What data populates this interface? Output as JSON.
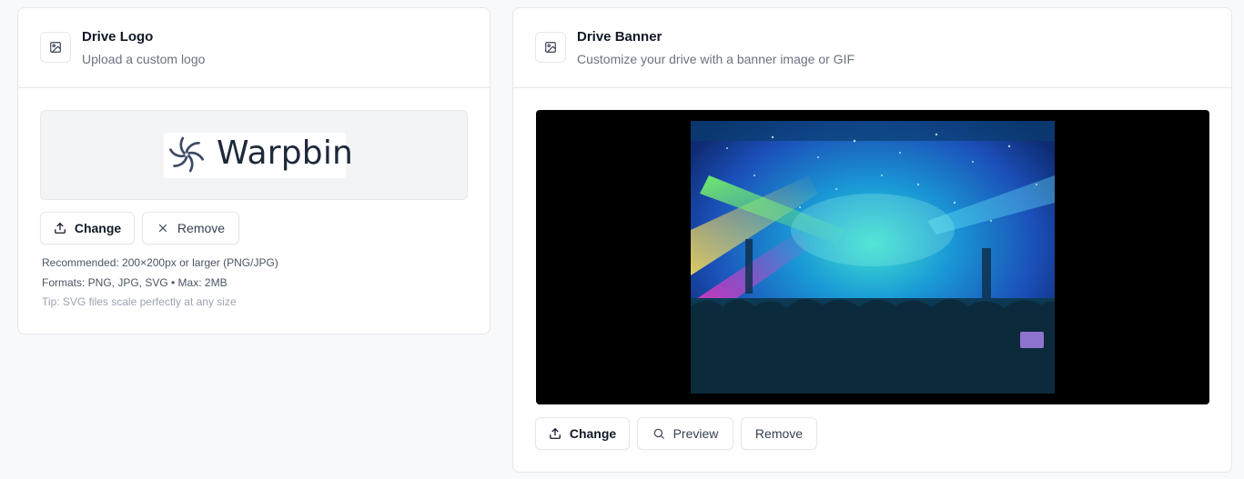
{
  "logo_card": {
    "title": "Drive Logo",
    "subtitle": "Upload a custom logo",
    "header_icon": "image-icon",
    "logo_wordmark": "Warpbin",
    "buttons": {
      "change": "Change",
      "remove": "Remove"
    },
    "hints": [
      "Recommended: 200×200px or larger (PNG/JPG)",
      "Formats: PNG, JPG, SVG • Max: 2MB",
      "Tip: SVG files scale perfectly at any size"
    ]
  },
  "banner_card": {
    "title": "Drive Banner",
    "subtitle": "Customize your drive with a banner image or GIF",
    "header_icon": "image-icon",
    "buttons": {
      "change": "Change",
      "preview": "Preview",
      "remove": "Remove"
    }
  },
  "icons": {
    "upload": "upload-icon",
    "close": "x-icon",
    "search": "search-icon"
  },
  "colors": {
    "page_bg": "#f8f9fb",
    "card_bg": "#ffffff",
    "border": "#e5e7eb",
    "text_primary": "#111827",
    "text_secondary": "#6b7280",
    "logo_color": "#3d4a63"
  }
}
